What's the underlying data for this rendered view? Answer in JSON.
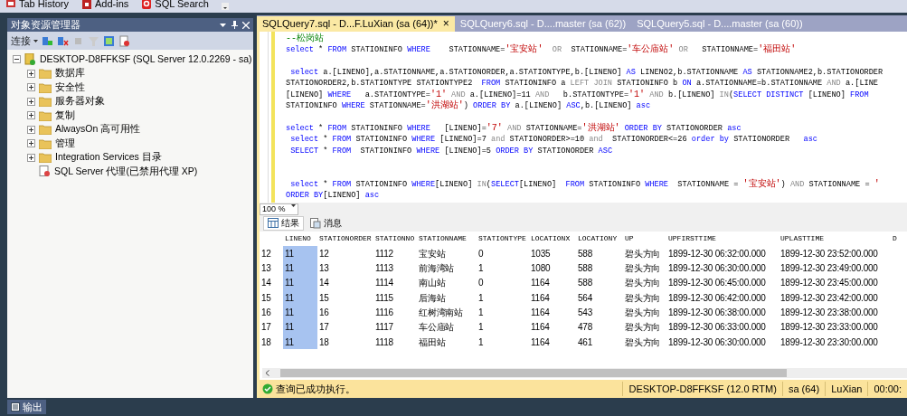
{
  "toolbar": [
    {
      "label": "Tab History"
    },
    {
      "label": "Add-ins"
    },
    {
      "label": "SQL Search"
    }
  ],
  "object_explorer": {
    "title": "对象资源管理器",
    "connect": "连接",
    "tree": [
      {
        "label": "DESKTOP-D8FFKSF (SQL Server 12.0.2269 - sa)",
        "kind": "server",
        "expanded": true,
        "children": [
          {
            "label": "数据库",
            "kind": "folder",
            "expanded": false
          },
          {
            "label": "安全性",
            "kind": "folder",
            "expanded": false
          },
          {
            "label": "服务器对象",
            "kind": "folder",
            "expanded": false
          },
          {
            "label": "复制",
            "kind": "folder",
            "expanded": false
          },
          {
            "label": "AlwaysOn 高可用性",
            "kind": "folder",
            "expanded": false
          },
          {
            "label": "管理",
            "kind": "folder",
            "expanded": false
          },
          {
            "label": "Integration Services 目录",
            "kind": "folder",
            "expanded": false
          },
          {
            "label": "SQL Server 代理(已禁用代理 XP)",
            "kind": "agent"
          }
        ]
      }
    ]
  },
  "editor": {
    "tabs": [
      {
        "label": "SQLQuery7.sql - D...F.LuXian (sa (64))*",
        "selected": true,
        "close": "×"
      },
      {
        "label": "SQLQuery6.sql - D....master (sa (62))",
        "selected": false
      },
      {
        "label": "SQLQuery5.sql - D....master (sa (60))",
        "selected": false
      }
    ],
    "lines": [
      {
        "segments": [
          {
            "kind": "cm",
            "text": "--松岗站"
          }
        ]
      },
      {
        "segments": [
          {
            "kind": "kw",
            "text": "select"
          },
          {
            "kind": "tx",
            "text": " * "
          },
          {
            "kind": "kw",
            "text": "FROM"
          },
          {
            "kind": "tx",
            "text": " STATIONINFO "
          },
          {
            "kind": "kw",
            "text": "WHERE"
          },
          {
            "kind": "tx",
            "text": "    STATIONNAME="
          },
          {
            "kind": "str",
            "text": "'宝安站'"
          },
          {
            "kind": "op",
            "text": "  OR  "
          },
          {
            "kind": "tx",
            "text": "STATIONNAME="
          },
          {
            "kind": "str",
            "text": "'车公庙站'"
          },
          {
            "kind": "op",
            "text": " OR   "
          },
          {
            "kind": "tx",
            "text": "STATIONNAME="
          },
          {
            "kind": "str",
            "text": "'福田站'"
          }
        ]
      },
      {
        "kind": "after_blank",
        "segments": [
          {
            "kind": "kw",
            "text": " select"
          },
          {
            "kind": "tx",
            "text": " a.[LINENO],a.STATIONNAME,a.STATIONORDER,a.STATIONTYPE,b.[LINENO] "
          },
          {
            "kind": "kw",
            "text": "AS"
          },
          {
            "kind": "tx",
            "text": " LINENO2,b.STATIONNAME "
          },
          {
            "kind": "kw",
            "text": "AS"
          },
          {
            "kind": "tx",
            "text": " STATIONNAME2,b.STATIONORDER"
          }
        ]
      },
      {
        "segments": [
          {
            "kind": "tx",
            "text": "STATIONORDER2,b.STATIONTYPE STATIONTYPE2  "
          },
          {
            "kind": "kw",
            "text": "FROM"
          },
          {
            "kind": "tx",
            "text": " STATIONINFO a "
          },
          {
            "kind": "op",
            "text": "LEFT JOIN"
          },
          {
            "kind": "tx",
            "text": " STATIONINFO b "
          },
          {
            "kind": "kw",
            "text": "ON"
          },
          {
            "kind": "tx",
            "text": " a.STATIONNAME=b.STATIONNAME "
          },
          {
            "kind": "op",
            "text": "AND"
          },
          {
            "kind": "tx",
            "text": " a.[LINE"
          }
        ]
      },
      {
        "segments": [
          {
            "kind": "tx",
            "text": "[LINENO] "
          },
          {
            "kind": "kw",
            "text": "WHERE"
          },
          {
            "kind": "tx",
            "text": "   a.STATIONTYPE="
          },
          {
            "kind": "str",
            "text": "'1'"
          },
          {
            "kind": "op",
            "text": " AND "
          },
          {
            "kind": "tx",
            "text": "a.[LINENO]=11 "
          },
          {
            "kind": "op",
            "text": "AND"
          },
          {
            "kind": "tx",
            "text": "   b.STATIONTYPE="
          },
          {
            "kind": "str",
            "text": "'1'"
          },
          {
            "kind": "op",
            "text": " AND "
          },
          {
            "kind": "tx",
            "text": "b.[LINENO] "
          },
          {
            "kind": "op",
            "text": "IN"
          },
          {
            "kind": "tx",
            "text": "("
          },
          {
            "kind": "kw",
            "text": "SELECT DISTINCT"
          },
          {
            "kind": "tx",
            "text": " [LINENO] "
          },
          {
            "kind": "kw",
            "text": "FROM"
          }
        ]
      },
      {
        "segments": [
          {
            "kind": "tx",
            "text": "STATIONINFO "
          },
          {
            "kind": "kw",
            "text": "WHERE"
          },
          {
            "kind": "tx",
            "text": " STATIONNAME="
          },
          {
            "kind": "str",
            "text": "'洪湖站'"
          },
          {
            "kind": "tx",
            "text": ") "
          },
          {
            "kind": "kw",
            "text": "ORDER BY"
          },
          {
            "kind": "tx",
            "text": " a.[LINENO] "
          },
          {
            "kind": "kw",
            "text": "ASC"
          },
          {
            "kind": "tx",
            "text": ",b.[LINENO] "
          },
          {
            "kind": "kw",
            "text": "asc"
          }
        ]
      },
      {
        "kind": "after_blank",
        "segments": [
          {
            "kind": "kw",
            "text": "select"
          },
          {
            "kind": "tx",
            "text": " * "
          },
          {
            "kind": "kw",
            "text": "FROM"
          },
          {
            "kind": "tx",
            "text": " STATIONINFO "
          },
          {
            "kind": "kw",
            "text": "WHERE"
          },
          {
            "kind": "tx",
            "text": "   [LINENO]="
          },
          {
            "kind": "str",
            "text": "'7'"
          },
          {
            "kind": "op",
            "text": " AND "
          },
          {
            "kind": "tx",
            "text": "STATIONNAME="
          },
          {
            "kind": "str",
            "text": "'洪湖站'"
          },
          {
            "kind": "kw",
            "text": " ORDER BY"
          },
          {
            "kind": "tx",
            "text": " STATIONORDER "
          },
          {
            "kind": "kw",
            "text": "asc"
          }
        ]
      },
      {
        "segments": [
          {
            "kind": "kw",
            "text": " select"
          },
          {
            "kind": "tx",
            "text": " * "
          },
          {
            "kind": "kw",
            "text": "FROM"
          },
          {
            "kind": "tx",
            "text": " STATIONINFO "
          },
          {
            "kind": "kw",
            "text": "WHERE"
          },
          {
            "kind": "tx",
            "text": " [LINENO]=7 "
          },
          {
            "kind": "op",
            "text": "and"
          },
          {
            "kind": "tx",
            "text": " STATIONORDER>=10 "
          },
          {
            "kind": "op",
            "text": "and"
          },
          {
            "kind": "tx",
            "text": "  STATIONORDER<=26 "
          },
          {
            "kind": "kw",
            "text": "order by"
          },
          {
            "kind": "tx",
            "text": " STATIONORDER   "
          },
          {
            "kind": "kw",
            "text": "asc"
          }
        ]
      },
      {
        "segments": [
          {
            "kind": "kw",
            "text": " SELECT"
          },
          {
            "kind": "tx",
            "text": " * "
          },
          {
            "kind": "kw",
            "text": "FROM"
          },
          {
            "kind": "tx",
            "text": "  STATIONINFO "
          },
          {
            "kind": "kw",
            "text": "WHERE"
          },
          {
            "kind": "tx",
            "text": " [LINENO]=5 "
          },
          {
            "kind": "kw",
            "text": "ORDER BY"
          },
          {
            "kind": "tx",
            "text": " STATIONORDER "
          },
          {
            "kind": "kw",
            "text": "ASC"
          }
        ]
      },
      {
        "kind": "after_two_blanks",
        "segments": [
          {
            "kind": "kw",
            "text": " select"
          },
          {
            "kind": "tx",
            "text": " * "
          },
          {
            "kind": "kw",
            "text": "FROM"
          },
          {
            "kind": "tx",
            "text": " STATIONINFO "
          },
          {
            "kind": "kw",
            "text": "WHERE"
          },
          {
            "kind": "tx",
            "text": "[LINENO] "
          },
          {
            "kind": "op",
            "text": "IN"
          },
          {
            "kind": "tx",
            "text": "("
          },
          {
            "kind": "kw",
            "text": "SELECT"
          },
          {
            "kind": "tx",
            "text": "[LINENO]  "
          },
          {
            "kind": "kw",
            "text": "FROM"
          },
          {
            "kind": "tx",
            "text": " STATIONINFO "
          },
          {
            "kind": "kw",
            "text": "WHERE"
          },
          {
            "kind": "tx",
            "text": "  STATIONNAME = "
          },
          {
            "kind": "str",
            "text": "'宝安站'"
          },
          {
            "kind": "tx",
            "text": ") "
          },
          {
            "kind": "op",
            "text": "AND"
          },
          {
            "kind": "tx",
            "text": " STATIONNAME = "
          },
          {
            "kind": "str",
            "text": "'"
          }
        ]
      },
      {
        "segments": [
          {
            "kind": "kw",
            "text": "ORDER BY"
          },
          {
            "kind": "tx",
            "text": "[LINENO] "
          },
          {
            "kind": "kw",
            "text": "asc"
          }
        ]
      }
    ],
    "zoom": "100 %"
  },
  "results": {
    "tabs": [
      {
        "label": "结果",
        "selected": true
      },
      {
        "label": "消息",
        "selected": false
      }
    ],
    "columns": [
      "LINENO",
      "STATIONORDER",
      "STATIONNO",
      "STATIONNAME",
      "STATIONTYPE",
      "LOCATIONX",
      "LOCATIONY",
      "UP",
      "UPFIRSTTIME",
      "UPLASTTIME",
      "D"
    ],
    "rows": [
      {
        "header": "12",
        "selected": true,
        "cells": [
          "11",
          "12",
          "1112",
          "宝安站",
          "0",
          "1035",
          "588",
          "碧头方向",
          "1899-12-30 06:32:00.000",
          "1899-12-30 23:52:00.000"
        ]
      },
      {
        "header": "13",
        "selected": true,
        "cells": [
          "11",
          "13",
          "1113",
          "前海湾站",
          "1",
          "1080",
          "588",
          "碧头方向",
          "1899-12-30 06:30:00.000",
          "1899-12-30 23:49:00.000"
        ]
      },
      {
        "header": "14",
        "selected": true,
        "cells": [
          "11",
          "14",
          "1114",
          "南山站",
          "0",
          "1164",
          "588",
          "碧头方向",
          "1899-12-30 06:45:00.000",
          "1899-12-30 23:45:00.000"
        ]
      },
      {
        "header": "15",
        "selected": true,
        "cells": [
          "11",
          "15",
          "1115",
          "后海站",
          "1",
          "1164",
          "564",
          "碧头方向",
          "1899-12-30 06:42:00.000",
          "1899-12-30 23:42:00.000"
        ]
      },
      {
        "header": "16",
        "selected": true,
        "cells": [
          "11",
          "16",
          "1116",
          "红树湾南站",
          "1",
          "1164",
          "543",
          "碧头方向",
          "1899-12-30 06:38:00.000",
          "1899-12-30 23:38:00.000"
        ]
      },
      {
        "header": "17",
        "selected": true,
        "cells": [
          "11",
          "17",
          "1117",
          "车公庙站",
          "1",
          "1164",
          "478",
          "碧头方向",
          "1899-12-30 06:33:00.000",
          "1899-12-30 23:33:00.000"
        ]
      },
      {
        "header": "18",
        "selected": true,
        "cells": [
          "11",
          "18",
          "1118",
          "福田站",
          "1",
          "1164",
          "461",
          "碧头方向",
          "1899-12-30 06:30:00.000",
          "1899-12-30 23:30:00.000"
        ]
      }
    ]
  },
  "status_bar": {
    "message": "查询已成功执行。",
    "server": "DESKTOP-D8FFKSF (12.0 RTM)",
    "user": "sa (64)",
    "database": "LuXian",
    "time": "00:00:"
  },
  "output_tab": "输出"
}
